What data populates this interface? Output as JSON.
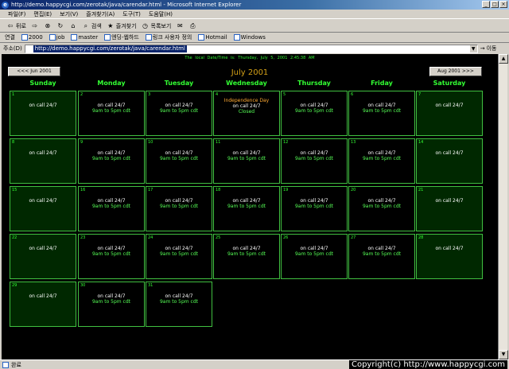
{
  "window": {
    "title": "http://demo.happycgi.com/zerotak/java/carendar.html - Microsoft Internet Explorer"
  },
  "menu": [
    "파일(F)",
    "편집(E)",
    "보기(V)",
    "즐겨찾기(A)",
    "도구(T)",
    "도움말(H)"
  ],
  "toolbar": {
    "back": "뒤로",
    "search": "검색",
    "favorites": "즐겨찾기",
    "history": "목록보기"
  },
  "links": {
    "label": "연결",
    "items": [
      "2000",
      "job",
      "master",
      "엔딩-웹하드",
      "링크 사용자 정의",
      "Hotmail",
      "Windows"
    ]
  },
  "address": {
    "label": "주소(D)",
    "url": "http://demo.happycgi.com/zerotak/java/carendar.html",
    "go": "이동"
  },
  "calendar": {
    "local_time_label": "The local Date/Time is:",
    "local_date": "Thursday, July 5, 2001",
    "local_time": "2:45:38 AM",
    "month_title": "July 2001",
    "prev_label": "<<< Jun 2001",
    "next_label": "Aug 2001 >>>",
    "days": [
      "Sunday",
      "Monday",
      "Tuesday",
      "Wednesday",
      "Thursday",
      "Friday",
      "Saturday"
    ],
    "weekend_text": "on call 24/7",
    "weekday_text_1": "on call 24/7",
    "weekday_text_2": "9am to 5pm cdt",
    "holiday_name": "Independence Day",
    "holiday_closed": "Closed"
  },
  "status": {
    "text": "완료",
    "copyright": "Copyright(c) http://www.happycgi.com"
  },
  "colors": {
    "cell_border": "#40c040",
    "weekend_bg": "#002800",
    "month_title": "#d4a017",
    "day_header": "#33ff33"
  }
}
